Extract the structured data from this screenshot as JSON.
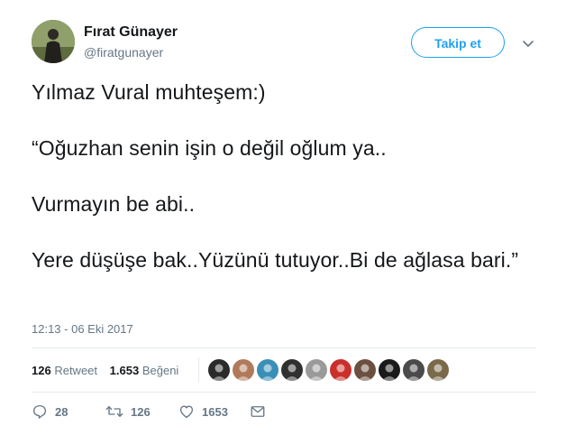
{
  "author": {
    "display_name": "Fırat Günayer",
    "handle": "@firatgunayer"
  },
  "follow_button": "Takip et",
  "tweet_text": [
    "Yılmaz Vural muhteşem:)",
    "“Oğuzhan senin işin o değil oğlum ya..",
    "Vurmayın be abi..",
    "Yere düşüşe bak..Yüzünü tutuyor..Bi de ağlasa bari.”"
  ],
  "timestamp": "12:13 - 06 Eki 2017",
  "stats": {
    "retweet_count": "126",
    "retweet_label": "Retweet",
    "like_count": "1.653",
    "like_label": "Beğeni"
  },
  "liker_avatars": [
    {
      "icon": "besiktas-logo-avatar",
      "color": "#2b2b2b"
    },
    {
      "icon": "user-avatar",
      "color": "#b07a5a"
    },
    {
      "icon": "user-avatar",
      "color": "#3a8fb7"
    },
    {
      "icon": "user-avatar",
      "color": "#303030"
    },
    {
      "icon": "user-avatar",
      "color": "#9a9a9a"
    },
    {
      "icon": "user-avatar",
      "color": "#c9302c"
    },
    {
      "icon": "user-avatar",
      "color": "#6b5040"
    },
    {
      "icon": "user-avatar",
      "color": "#1a1a1a"
    },
    {
      "icon": "user-avatar",
      "color": "#4a4a4a"
    },
    {
      "icon": "user-avatar",
      "color": "#7a6a4a"
    }
  ],
  "actions": {
    "reply_count": "28",
    "retweet_count": "126",
    "like_count": "1653"
  },
  "colors": {
    "accent": "#1da1f2",
    "muted": "#657786",
    "text": "#14171a",
    "divider": "#e6ecf0"
  }
}
